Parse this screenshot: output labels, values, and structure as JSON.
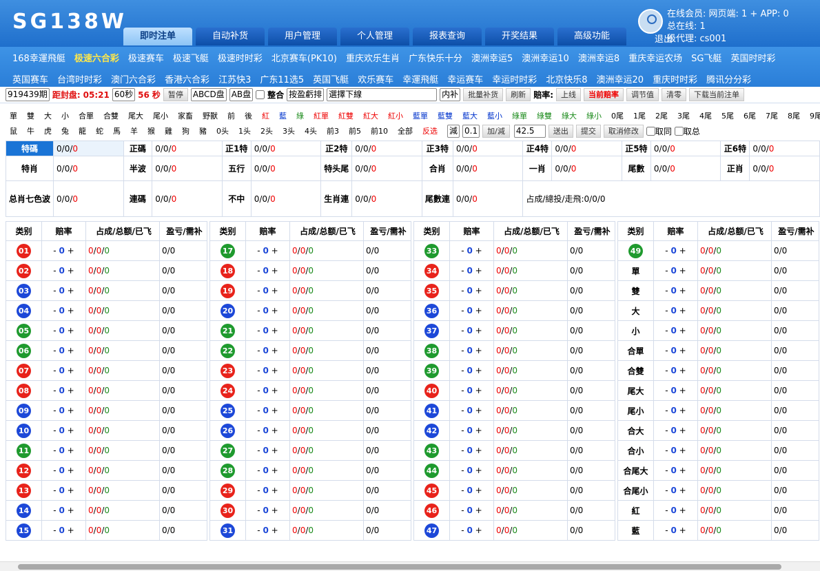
{
  "header": {
    "logo": "SG138W",
    "logout": "退出",
    "online": [
      "在线会员: 网页端: 1 + APP: 0",
      "总在线: 1",
      "级代理: cs001"
    ],
    "tabs": [
      "即时注单",
      "自动补货",
      "用户管理",
      "个人管理",
      "报表查询",
      "开奖结果",
      "高级功能"
    ]
  },
  "lotteries": {
    "row1": [
      "168幸運飛艇",
      "极速六合彩",
      "极速赛车",
      "极速飞艇",
      "极速时时彩",
      "北京赛车(PK10)",
      "重庆欢乐生肖",
      "广东快乐十分",
      "澳洲幸运5",
      "澳洲幸运10",
      "澳洲幸运8",
      "重庆幸运农场",
      "SG飞艇",
      "英国时时彩"
    ],
    "row2": [
      "英国赛车",
      "台湾时时彩",
      "澳门六合彩",
      "香港六合彩",
      "江苏快3",
      "广东11选5",
      "英国飞艇",
      "欢乐赛车",
      "幸運飛艇",
      "幸运赛车",
      "幸运时时彩",
      "北京快乐8",
      "澳洲幸运20",
      "重庆时时彩",
      "腾讯分分彩"
    ],
    "current": "极速六合彩"
  },
  "controls": {
    "period": "919439期",
    "close_label": "距封盘:",
    "close_time": "05:21",
    "interval": "60秒",
    "countdown": "56",
    "sec": "秒",
    "pause": "暂停",
    "plate": "ABCD盘",
    "plate2": "AB盘",
    "merge": "整合",
    "sort": "按盈虧排",
    "line": "選擇下線",
    "fill": "内补",
    "batch": "批量补货",
    "refresh": "刷新",
    "odds_label": "賠率:",
    "up": "上线",
    "cur_odds": "当前赔率",
    "adjust": "调节值",
    "clear": "清零",
    "download": "下载当前注单"
  },
  "quick": {
    "row1": [
      "單",
      "雙",
      "大",
      "小",
      "合單",
      "合雙",
      "尾大",
      "尾小",
      "家畜",
      "野獸",
      "前",
      "後",
      "紅",
      "藍",
      "綠",
      "紅單",
      "紅雙",
      "紅大",
      "紅小",
      "藍單",
      "藍雙",
      "藍大",
      "藍小",
      "綠單",
      "綠雙",
      "綠大",
      "綠小",
      "0尾",
      "1尾",
      "2尾",
      "3尾",
      "4尾",
      "5尾",
      "6尾",
      "7尾",
      "8尾",
      "9尾"
    ],
    "row2": [
      "鼠",
      "牛",
      "虎",
      "兔",
      "龍",
      "蛇",
      "馬",
      "羊",
      "猴",
      "雞",
      "狗",
      "豬",
      "0头",
      "1头",
      "2头",
      "3头",
      "4头",
      "前3",
      "前5",
      "前10",
      "全部"
    ],
    "reverse": "反选",
    "op": "減",
    "step": "0.1",
    "addsub": "加/減",
    "val": "42.5",
    "out": "送出",
    "submit": "提交",
    "cancel": "取消修改",
    "same": "取同",
    "total": "取总"
  },
  "summary": [
    [
      {
        "k": "特碼",
        "v": "0/0/0"
      },
      {
        "k": "正碼",
        "v": "0/0/0"
      },
      {
        "k": "正1特",
        "v": "0/0/0"
      },
      {
        "k": "正2特",
        "v": "0/0/0"
      },
      {
        "k": "正3特",
        "v": "0/0/0"
      },
      {
        "k": "正4特",
        "v": "0/0/0"
      },
      {
        "k": "正5特",
        "v": "0/0/0"
      },
      {
        "k": "正6特",
        "v": "0/0/0"
      }
    ],
    [
      {
        "k": "特肖",
        "v": "0/0/0"
      },
      {
        "k": "半波",
        "v": "0/0/0"
      },
      {
        "k": "五行",
        "v": "0/0/0"
      },
      {
        "k": "特头尾",
        "v": "0/0/0"
      },
      {
        "k": "合肖",
        "v": "0/0/0"
      },
      {
        "k": "一肖",
        "v": "0/0/0"
      },
      {
        "k": "尾數",
        "v": "0/0/0"
      },
      {
        "k": "正肖",
        "v": "0/0/0"
      }
    ],
    [
      {
        "k": "总肖七色波",
        "v": "0/0/0"
      },
      {
        "k": "連碼",
        "v": "0/0/0"
      },
      {
        "k": "不中",
        "v": "0/0/0"
      },
      {
        "k": "生肖連",
        "v": "0/0/0"
      },
      {
        "k": "尾數連",
        "v": "0/0/0"
      },
      {
        "k": "",
        "v": "占成/總投/走飛:0/0/0"
      }
    ]
  ],
  "table": {
    "headers": [
      "类别",
      "赔率",
      "占成/总额/已飞",
      "盈亏/需补"
    ],
    "odds": "0",
    "cell": "0/0/0",
    "pl": "0/0",
    "cols": [
      [
        [
          "01",
          "r"
        ],
        [
          "02",
          "r"
        ],
        [
          "03",
          "b"
        ],
        [
          "04",
          "b"
        ],
        [
          "05",
          "g"
        ],
        [
          "06",
          "g"
        ],
        [
          "07",
          "r"
        ],
        [
          "08",
          "r"
        ],
        [
          "09",
          "b"
        ],
        [
          "10",
          "b"
        ],
        [
          "11",
          "g"
        ],
        [
          "12",
          "r"
        ],
        [
          "13",
          "r"
        ],
        [
          "14",
          "b"
        ],
        [
          "15",
          "b"
        ]
      ],
      [
        [
          "17",
          "g"
        ],
        [
          "18",
          "r"
        ],
        [
          "19",
          "r"
        ],
        [
          "20",
          "b"
        ],
        [
          "21",
          "g"
        ],
        [
          "22",
          "g"
        ],
        [
          "23",
          "r"
        ],
        [
          "24",
          "r"
        ],
        [
          "25",
          "b"
        ],
        [
          "26",
          "b"
        ],
        [
          "27",
          "g"
        ],
        [
          "28",
          "g"
        ],
        [
          "29",
          "r"
        ],
        [
          "30",
          "r"
        ],
        [
          "31",
          "b"
        ]
      ],
      [
        [
          "33",
          "g"
        ],
        [
          "34",
          "r"
        ],
        [
          "35",
          "r"
        ],
        [
          "36",
          "b"
        ],
        [
          "37",
          "b"
        ],
        [
          "38",
          "g"
        ],
        [
          "39",
          "g"
        ],
        [
          "40",
          "r"
        ],
        [
          "41",
          "b"
        ],
        [
          "42",
          "b"
        ],
        [
          "43",
          "g"
        ],
        [
          "44",
          "g"
        ],
        [
          "45",
          "r"
        ],
        [
          "46",
          "r"
        ],
        [
          "47",
          "b"
        ]
      ],
      [
        [
          "49",
          "g"
        ],
        [
          "單",
          ""
        ],
        [
          "雙",
          ""
        ],
        [
          "大",
          ""
        ],
        [
          "小",
          ""
        ],
        [
          "合單",
          ""
        ],
        [
          "合雙",
          ""
        ],
        [
          "尾大",
          ""
        ],
        [
          "尾小",
          ""
        ],
        [
          "合大",
          ""
        ],
        [
          "合小",
          ""
        ],
        [
          "合尾大",
          ""
        ],
        [
          "合尾小",
          ""
        ],
        [
          "紅",
          ""
        ],
        [
          "藍",
          ""
        ]
      ]
    ]
  }
}
